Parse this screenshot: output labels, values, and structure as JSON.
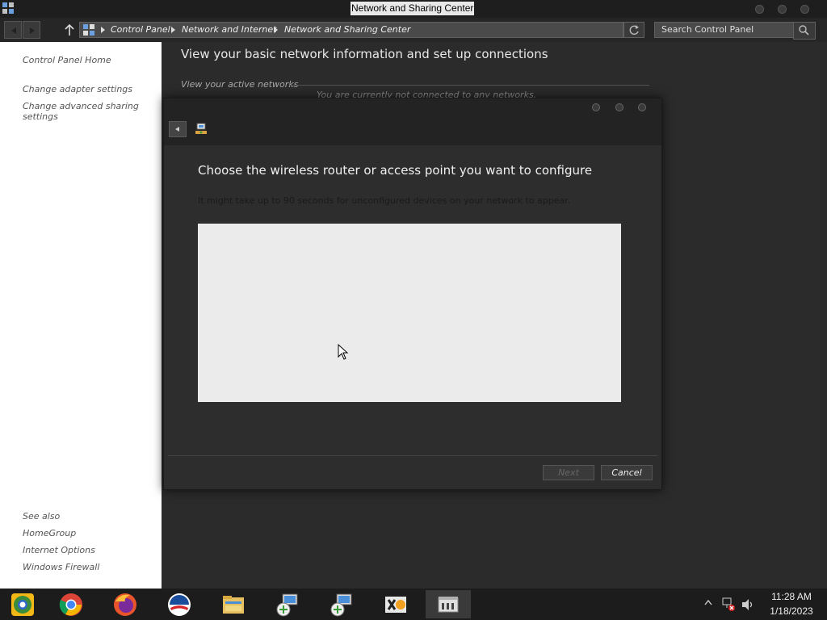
{
  "window": {
    "title": "Network and Sharing Center"
  },
  "address_bar": {
    "breadcrumbs": [
      "Control Panel",
      "Network and Internet",
      "Network and Sharing Center"
    ]
  },
  "search": {
    "placeholder": "Search Control Panel"
  },
  "sidebar": {
    "home": "Control Panel Home",
    "links": [
      "Change adapter settings",
      "Change advanced sharing settings"
    ],
    "see_also_heading": "See also",
    "see_also": [
      "HomeGroup",
      "Internet Options",
      "Windows Firewall"
    ]
  },
  "main": {
    "title": "View your basic network information and set up connections",
    "active_networks": "View your active networks",
    "not_connected": "You are currently not connected to any networks."
  },
  "dialog": {
    "heading": "Choose the wireless router or access point you want to configure",
    "description": "It might take up to 90 seconds for unconfigured devices on your network to appear.",
    "next_label": "Next",
    "cancel_label": "Cancel"
  },
  "taskbar": {
    "apps": [
      "chrome-canary-icon",
      "chrome-icon",
      "firefox-icon",
      "obama-logo-icon",
      "file-explorer-icon",
      "network-connection-icon",
      "network-setup-icon",
      "xd-app-icon",
      "control-panel-icon"
    ],
    "time": "11:28 AM",
    "date": "1/18/2023"
  }
}
